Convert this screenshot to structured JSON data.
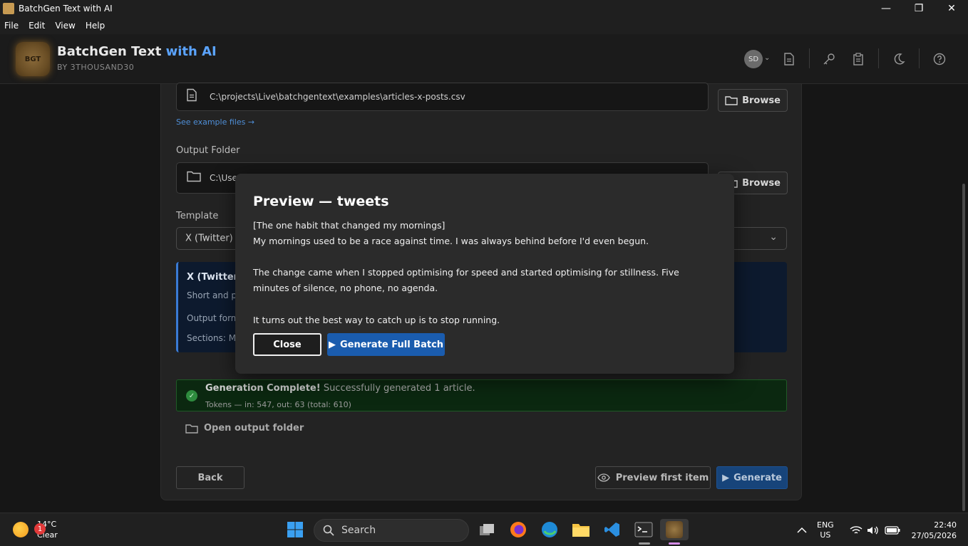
{
  "window": {
    "title": "BatchGen Text with AI",
    "minimize": "—",
    "maximize": "❐",
    "close": "✕"
  },
  "menu": [
    "File",
    "Edit",
    "View",
    "Help"
  ],
  "header": {
    "logo_text": "BGT",
    "brand_main": "BatchGen Text ",
    "brand_accent": "with AI",
    "byline": "BY 3THOUSAND30",
    "avatar_initials": "SD"
  },
  "form": {
    "input_file_path": "C:\\projects\\Live\\batchgentext\\examples\\articles-x-posts.csv",
    "browse_label": "Browse",
    "example_link": "See example files →",
    "output_folder_label": "Output Folder",
    "output_folder_path": "C:\\Use",
    "template_label": "Template",
    "template_value": "X (Twitter) F",
    "template_card": {
      "name": "X (Twitter)",
      "desc": "Short and pu",
      "format": "Output forma",
      "sections": "Sections: Mai"
    }
  },
  "status": {
    "title": "Generation Complete!",
    "message": " Successfully generated 1 article.",
    "tokens": "Tokens — in: 547, out: 63 (total: 610)"
  },
  "actions": {
    "open_folder": "Open output folder",
    "back": "Back",
    "preview": "Preview first item",
    "generate": "Generate"
  },
  "modal": {
    "title": "Preview — tweets",
    "line1": "[The one habit that changed my mornings]",
    "line2": "My mornings used to be a race against time. I was always behind before I'd even begun.",
    "line3": "The change came when I stopped optimising for speed and started optimising for stillness. Five minutes of silence, no phone, no agenda.",
    "line4": "It turns out the best way to catch up is to stop running.",
    "close": "Close",
    "generate_full": "Generate Full Batch"
  },
  "taskbar": {
    "weather_badge": "1",
    "temp": "14°C",
    "condition": "Clear",
    "search_placeholder": "Search",
    "lang_1": "ENG",
    "lang_2": "US",
    "time": "22:40",
    "date": "27/05/2026"
  },
  "colors": {
    "accent": "#1a5cae",
    "brand_accent": "#5ba4ff",
    "success_bg": "#0b2810"
  }
}
